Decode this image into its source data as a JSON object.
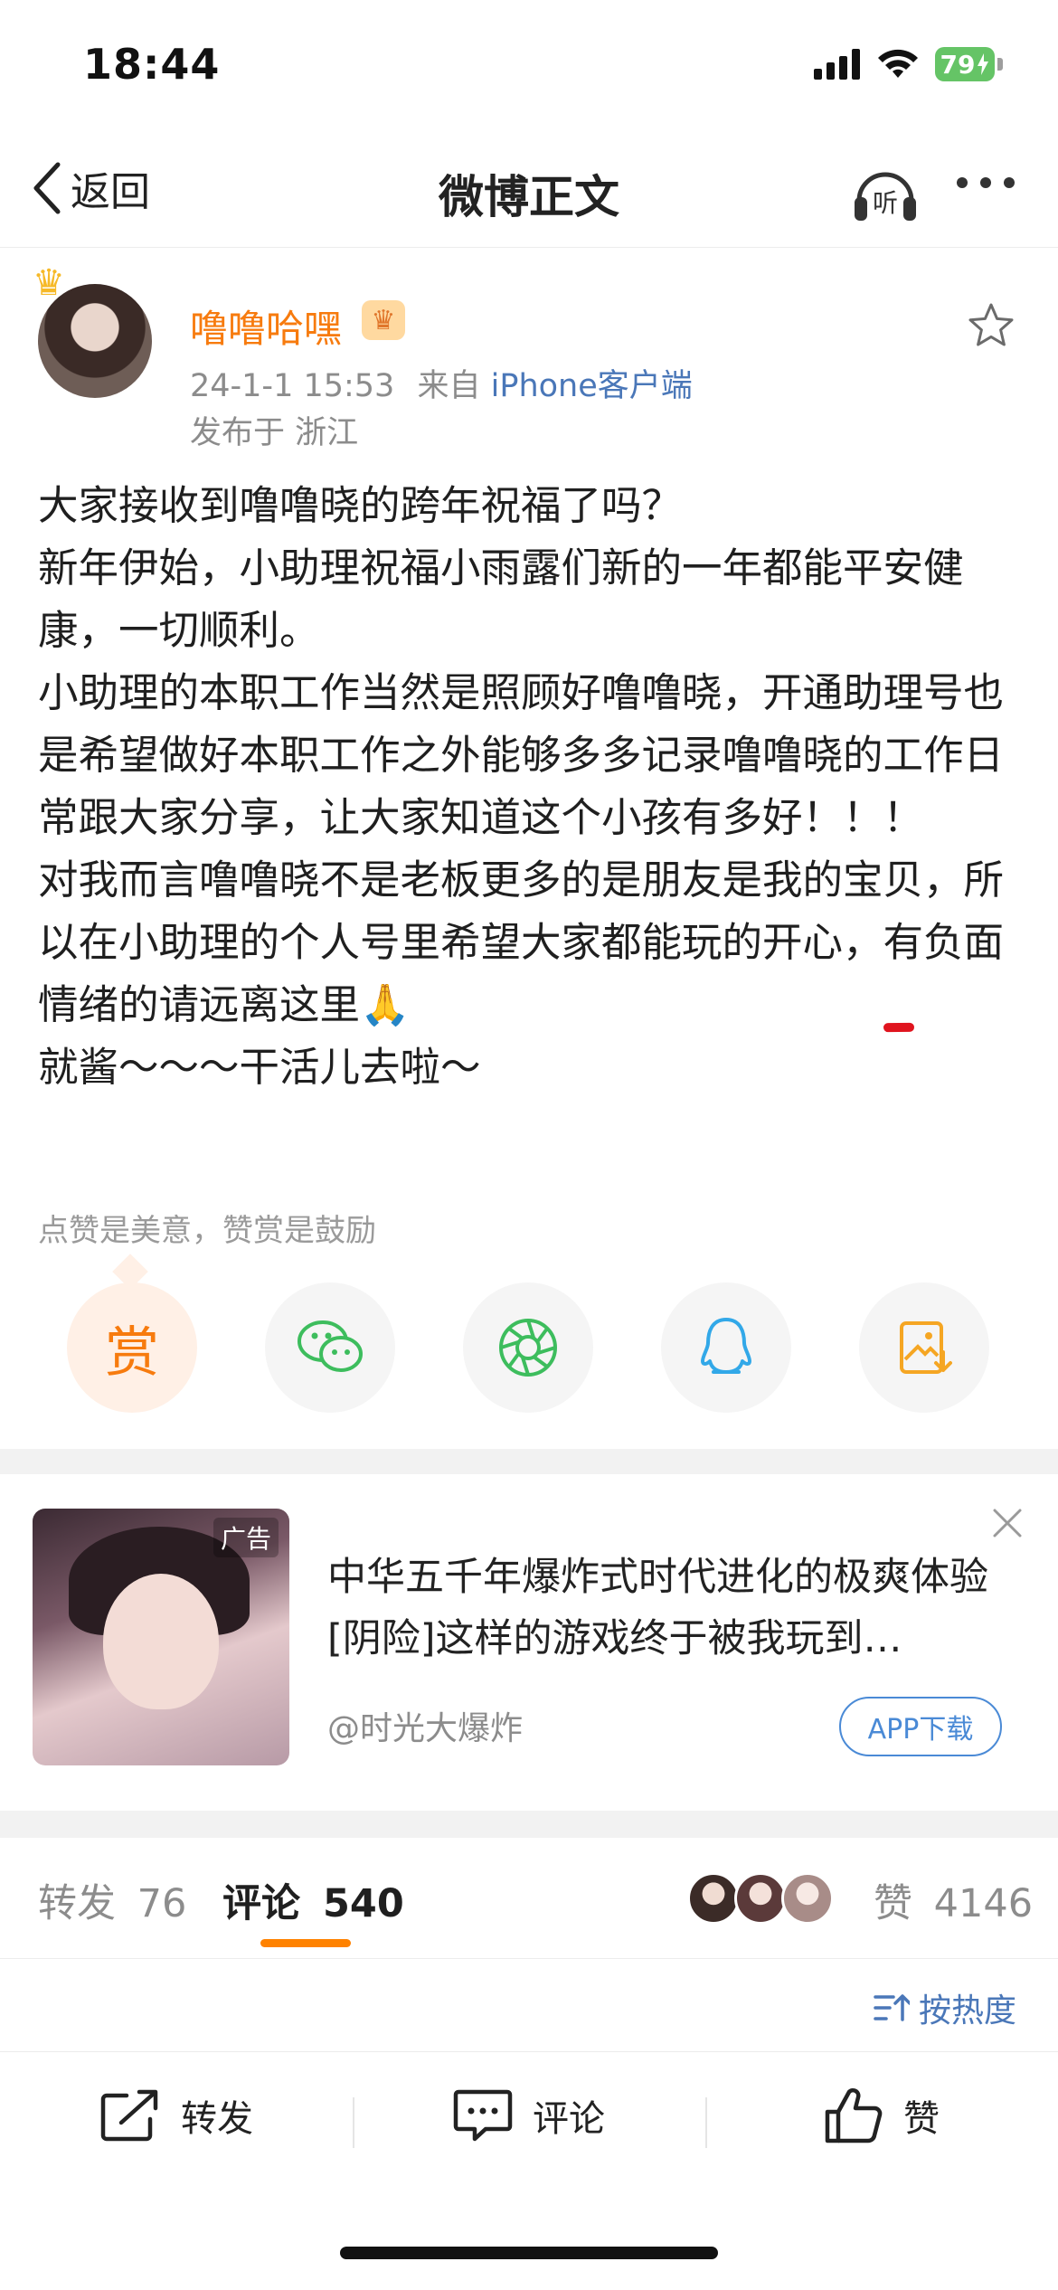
{
  "status_bar": {
    "time": "18:44",
    "battery": "79",
    "icons": [
      "signal-icon",
      "wifi-icon",
      "battery-icon",
      "charging-bolt-icon"
    ]
  },
  "nav": {
    "back_label": "返回",
    "title": "微博正文",
    "listen_label": "听",
    "icons": [
      "back-chevron-icon",
      "headphones-icon",
      "more-icon"
    ]
  },
  "post": {
    "author": "噜噜哈嘿",
    "crown_icon": "crown-icon",
    "vip_icon": "vip-badge-icon",
    "time": "24-1-1 15:53",
    "source_prefix": "来自",
    "source": "iPhone客户端",
    "location": "发布于 浙江",
    "paragraphs": {
      "p1": "大家接收到噜噜晓的跨年祝福了吗？",
      "p2": "新年伊始，小助理祝福小雨露们新的一年都能平安健康，一切顺利。",
      "p3": "小助理的本职工作当然是照顾好噜噜晓，开通助理号也是希望做好本职工作之外能够多多记录噜噜晓的工作日常跟大家分享，让大家知道这个小孩有多好！！！",
      "p4_a": "对我而言噜噜晓不是老板更多的是朋友是我的宝贝，所以在小助理的个人号里希望大家都能玩的开心，",
      "p4_b": "有负面情绪的请远离这里",
      "p4_emoji": "🙏",
      "p5": "就酱～～～干活儿去啦～"
    },
    "reward_hint": "点赞是美意，赞赏是鼓励",
    "reward_label": "赏",
    "share_icons": [
      "reward-icon",
      "wechat-icon",
      "moments-icon",
      "qq-icon",
      "save-image-icon"
    ]
  },
  "ad": {
    "tag": "广告",
    "text": "中华五千年爆炸式时代进化的极爽体验[阴险]这样的游戏终于被我玩到…",
    "author": "@时光大爆炸",
    "download_label": "APP下载"
  },
  "tabs": {
    "forward_label": "转发",
    "forward_count": "76",
    "comment_label": "评论",
    "comment_count": "540",
    "like_label": "赞",
    "like_count": "4146"
  },
  "sort": {
    "label": "按热度"
  },
  "actions": {
    "forward": "转发",
    "comment": "评论",
    "like": "赞"
  },
  "colors": {
    "accent_orange": "#f77b0e",
    "link_blue": "#4a77b8",
    "tab_indicator": "#ff8200",
    "underline_red": "#e0141e",
    "wechat_green": "#3dbd5d",
    "qq_blue": "#32a8e8",
    "save_orange": "#f5a623"
  }
}
